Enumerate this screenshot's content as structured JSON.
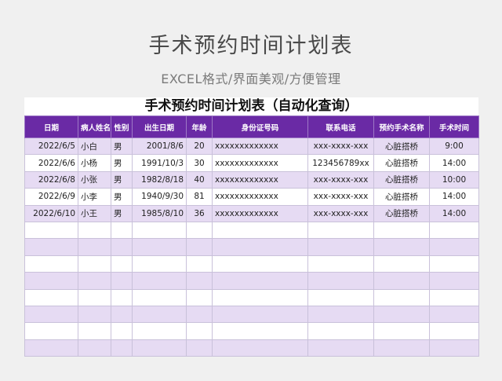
{
  "page": {
    "title": "手术预约时间计划表",
    "subtitle": "EXCEL格式/界面美观/方便管理"
  },
  "sheet": {
    "title": "手术预约时间计划表（自动化查询）",
    "columns": [
      "日期",
      "病人姓名",
      "性别",
      "出生日期",
      "年龄",
      "身份证号码",
      "联系电话",
      "预约手术名称",
      "手术时间"
    ],
    "rows": [
      [
        "2022/6/5",
        "小白",
        "男",
        "2001/8/6",
        "20",
        "xxxxxxxxxxxxx",
        "xxx-xxxx-xxx",
        "心脏搭桥",
        "9:00"
      ],
      [
        "2022/6/6",
        "小杨",
        "男",
        "1991/10/3",
        "30",
        "xxxxxxxxxxxxx",
        "123456789xx",
        "心脏搭桥",
        "14:00"
      ],
      [
        "2022/6/8",
        "小张",
        "男",
        "1982/8/18",
        "40",
        "xxxxxxxxxxxxx",
        "xxx-xxxx-xxx",
        "心脏搭桥",
        "10:00"
      ],
      [
        "2022/6/9",
        "小李",
        "男",
        "1940/9/30",
        "81",
        "xxxxxxxxxxxxx",
        "xxx-xxxx-xxx",
        "心脏搭桥",
        "14:00"
      ],
      [
        "2022/6/10",
        "小王",
        "男",
        "1985/8/10",
        "36",
        "xxxxxxxxxxxxx",
        "xxx-xxxx-xxx",
        "心脏搭桥",
        "14:00"
      ],
      [
        "",
        "",
        "",
        "",
        "",
        "",
        "",
        "",
        ""
      ],
      [
        "",
        "",
        "",
        "",
        "",
        "",
        "",
        "",
        ""
      ],
      [
        "",
        "",
        "",
        "",
        "",
        "",
        "",
        "",
        ""
      ],
      [
        "",
        "",
        "",
        "",
        "",
        "",
        "",
        "",
        ""
      ],
      [
        "",
        "",
        "",
        "",
        "",
        "",
        "",
        "",
        ""
      ],
      [
        "",
        "",
        "",
        "",
        "",
        "",
        "",
        "",
        ""
      ],
      [
        "",
        "",
        "",
        "",
        "",
        "",
        "",
        "",
        ""
      ],
      [
        "",
        "",
        "",
        "",
        "",
        "",
        "",
        "",
        ""
      ]
    ]
  },
  "colors": {
    "header_bg": "#6a2aa5",
    "row_alt_bg": "#e6dbf3",
    "page_bg": "#f0f0f0"
  }
}
